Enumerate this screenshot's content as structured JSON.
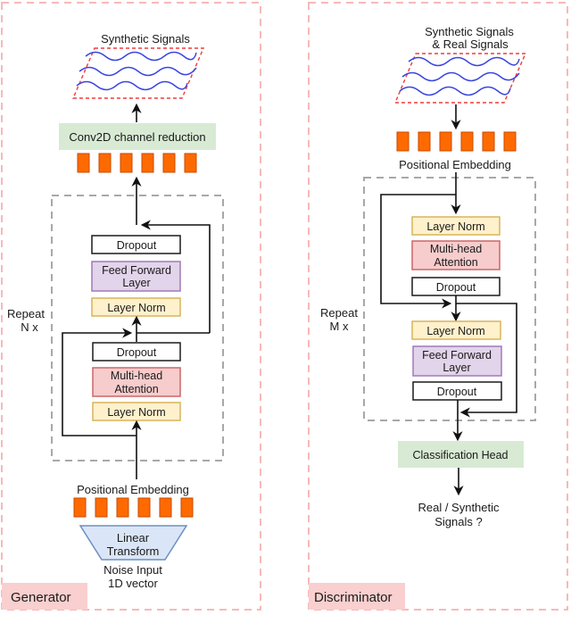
{
  "colors": {
    "panel_border": "#f7b9b9",
    "panel_label_bg": "#f9cfcf",
    "repeat_border": "#a8a8a8",
    "token": "#ff6a00",
    "signal_wave": "#3b46e0",
    "signal_plate_border": "#ef3b3b",
    "dropout_fill": "#ffffff",
    "feed_forward_fill": "#e2d4ea",
    "layer_norm_fill": "#fff1cc",
    "multi_head_attention_fill": "#f7cccc",
    "green_block_fill": "#d8ead4",
    "linear_transform_fill": "#dae6f7"
  },
  "generator": {
    "panel_label": "Generator",
    "output_title": "Synthetic Signals",
    "conv_block": "Conv2D channel reduction",
    "repeat_label": [
      "Repeat",
      "N x"
    ],
    "blocks_top_to_bottom": [
      {
        "type": "dropout",
        "lines": [
          "Dropout"
        ]
      },
      {
        "type": "feed_forward",
        "lines": [
          "Feed Forward",
          "Layer"
        ]
      },
      {
        "type": "layer_norm",
        "lines": [
          "Layer Norm"
        ]
      },
      {
        "type": "dropout",
        "lines": [
          "Dropout"
        ]
      },
      {
        "type": "multi_head_attention",
        "lines": [
          "Multi-head",
          "Attention"
        ]
      },
      {
        "type": "layer_norm",
        "lines": [
          "Layer Norm"
        ]
      }
    ],
    "positional_embedding": "Positional Embedding",
    "token_count": 6,
    "linear_transform": [
      "Linear",
      "Transform"
    ],
    "input_label": [
      "Noise Input",
      "1D vector"
    ]
  },
  "discriminator": {
    "panel_label": "Discriminator",
    "input_title": [
      "Synthetic Signals",
      "& Real Signals"
    ],
    "token_count": 6,
    "positional_embedding": "Positional Embedding",
    "repeat_label": [
      "Repeat",
      "M x"
    ],
    "blocks_top_to_bottom": [
      {
        "type": "layer_norm",
        "lines": [
          "Layer Norm"
        ]
      },
      {
        "type": "multi_head_attention",
        "lines": [
          "Multi-head",
          "Attention"
        ]
      },
      {
        "type": "dropout",
        "lines": [
          "Dropout"
        ]
      },
      {
        "type": "layer_norm",
        "lines": [
          "Layer Norm"
        ]
      },
      {
        "type": "feed_forward",
        "lines": [
          "Feed Forward",
          "Layer"
        ]
      },
      {
        "type": "dropout",
        "lines": [
          "Dropout"
        ]
      }
    ],
    "classification_head": "Classification Head",
    "output_label": [
      "Real / Synthetic",
      "Signals ?"
    ]
  }
}
